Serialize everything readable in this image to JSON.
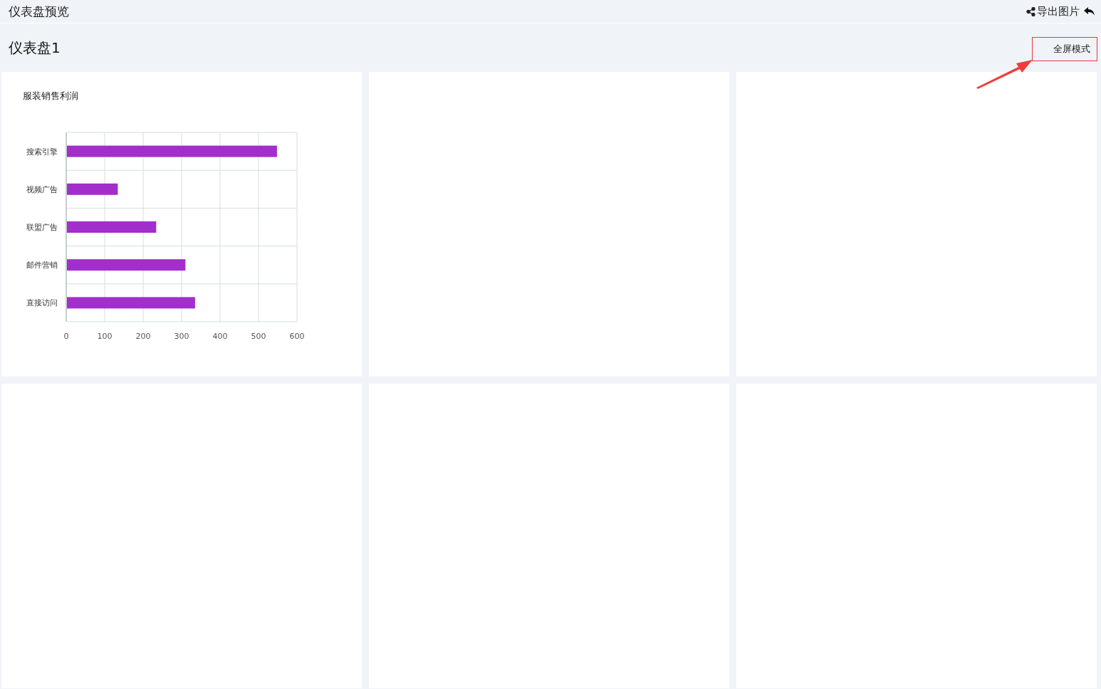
{
  "header": {
    "title": "仪表盘预览",
    "export_label": "导出图片"
  },
  "dashboard": {
    "title": "仪表盘1",
    "fullscreen_button": {
      "label": "全屏模式",
      "highlighted": true
    },
    "annotation": {
      "kind": "arrow"
    }
  },
  "panels": [
    {
      "kind": "chart",
      "title": "服装销售利润",
      "chart_data": {
        "type": "bar",
        "orientation": "horizontal",
        "grid": true,
        "categories": [
          "搜索引擎",
          "视频广告",
          "联盟广告",
          "邮件营销",
          "直接访问"
        ],
        "series": [
          {
            "color": "#a22ecb",
            "values": [
              548,
              134,
              234,
              310,
              335
            ]
          }
        ],
        "xlim": [
          0,
          600
        ],
        "xticks": [
          0,
          100,
          200,
          300,
          400,
          500,
          600
        ]
      }
    },
    {
      "kind": "blank"
    },
    {
      "kind": "blank"
    },
    {
      "kind": "blank"
    },
    {
      "kind": "blank"
    },
    {
      "kind": "blank"
    }
  ]
}
